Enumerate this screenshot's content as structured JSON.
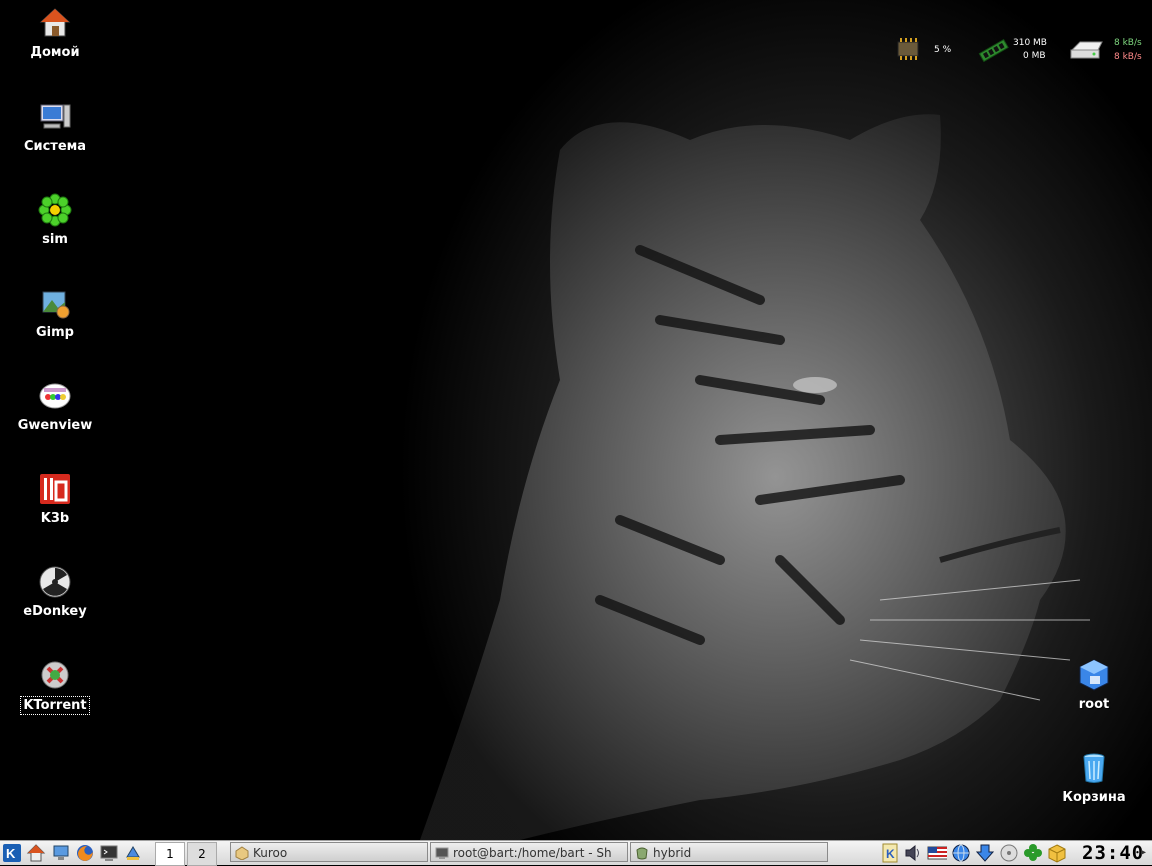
{
  "desktop": {
    "icons": [
      {
        "label": "Домой",
        "icon": "home-icon"
      },
      {
        "label": "Система",
        "icon": "computer-icon"
      },
      {
        "label": "sim",
        "icon": "sim-icon"
      },
      {
        "label": "Gimp",
        "icon": "gimp-icon"
      },
      {
        "label": "Gwenview",
        "icon": "gwenview-icon"
      },
      {
        "label": "K3b",
        "icon": "k3b-icon"
      },
      {
        "label": "eDonkey",
        "icon": "edonkey-icon"
      },
      {
        "label": "KTorrent",
        "icon": "ktorrent-icon"
      },
      {
        "label": "root",
        "icon": "root-cube-icon"
      },
      {
        "label": "Корзина",
        "icon": "trash-icon"
      }
    ]
  },
  "monitor": {
    "cpu": "5 %",
    "mem_used": "310 MB",
    "swap_used": "0 MB",
    "net_down": "8 kB/s",
    "net_up": "8 kB/s",
    "colors": {
      "down": "#7fd77f",
      "up": "#ff8a8a"
    }
  },
  "taskbar": {
    "pager": [
      "1",
      "2"
    ],
    "tasks": [
      {
        "label": "Kuroo",
        "icon": "kuroo-icon"
      },
      {
        "label": "root@bart:/home/bart - Sh",
        "icon": "terminal-icon"
      },
      {
        "label": "hybrid",
        "icon": "hybrid-icon"
      }
    ],
    "clock": "23:40"
  }
}
